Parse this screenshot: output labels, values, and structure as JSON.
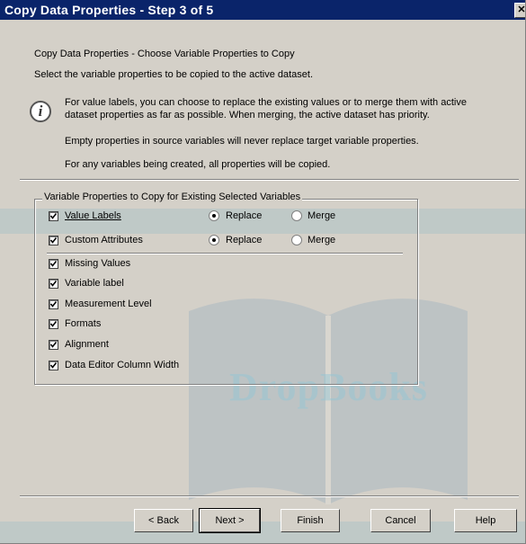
{
  "window": {
    "title": "Copy Data Properties - Step 3 of 5",
    "close_label": "✕"
  },
  "header": {
    "heading": "Copy Data Properties - Choose Variable Properties to Copy",
    "subheading": "Select the variable properties to be copied to the active dataset."
  },
  "info": {
    "icon": "info-icon",
    "icon_glyph": "i",
    "line1": "For value labels, you can choose to replace the existing values or to merge them with active",
    "line2": "dataset properties as far as possible.  When merging, the active dataset has priority.",
    "line3": "Empty properties in source variables will never replace target variable properties.",
    "line4": "For any variables being created, all properties will be copied."
  },
  "group": {
    "legend": "Variable Properties to Copy for Existing Selected Variables",
    "merge_rows": [
      {
        "label": "Value Labels",
        "checked": true,
        "replace_label": "Replace",
        "merge_label": "Merge",
        "selected": "Replace"
      },
      {
        "label": "Custom Attributes",
        "checked": true,
        "replace_label": "Replace",
        "merge_label": "Merge",
        "selected": "Replace"
      }
    ],
    "items": [
      {
        "label": "Missing Values",
        "checked": true
      },
      {
        "label": "Variable label",
        "checked": true
      },
      {
        "label": "Measurement Level",
        "checked": true
      },
      {
        "label": "Formats",
        "checked": true
      },
      {
        "label": "Alignment",
        "checked": true
      },
      {
        "label": "Data Editor Column Width",
        "checked": true
      }
    ]
  },
  "buttons": {
    "back": "< Back",
    "next": "Next >",
    "finish": "Finish",
    "cancel": "Cancel",
    "help": "Help"
  },
  "watermark": {
    "text": "DropBooks"
  }
}
